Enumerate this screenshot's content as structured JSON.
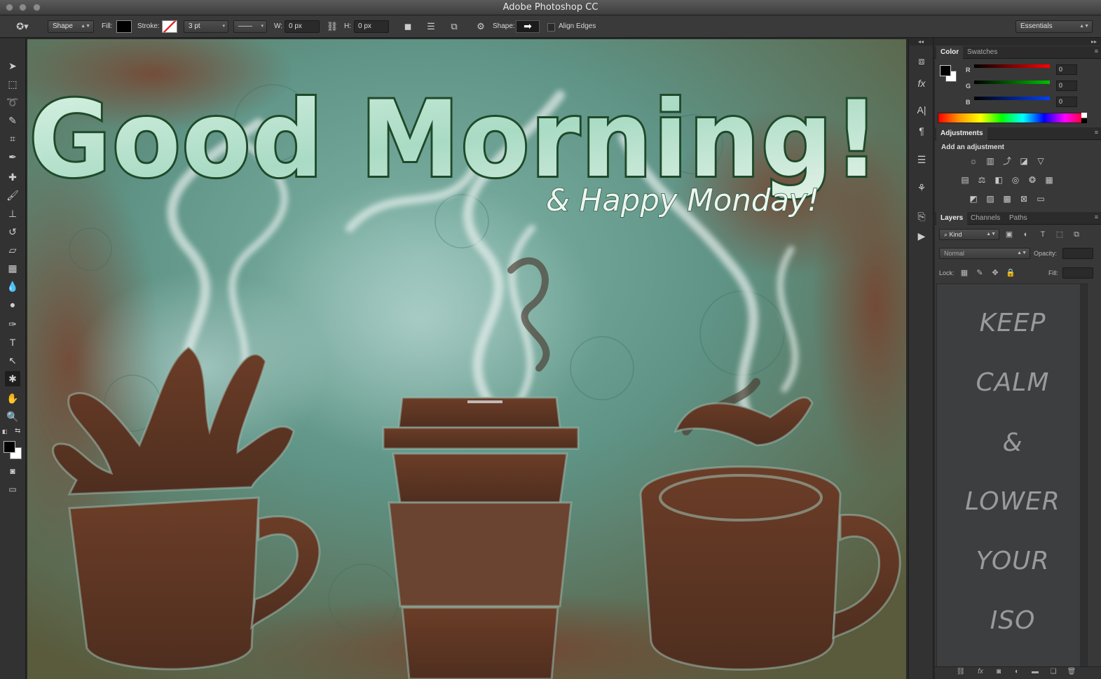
{
  "window": {
    "title": "Adobe Photoshop CC"
  },
  "options_bar": {
    "tool_mode": "Shape",
    "fill_label": "Fill:",
    "stroke_label": "Stroke:",
    "stroke_width": "3 pt",
    "w_label": "W:",
    "w_value": "0 px",
    "h_label": "H:",
    "h_value": "0 px",
    "shape_label": "Shape:",
    "align_edges_label": "Align Edges",
    "workspace": "Essentials"
  },
  "toolbox": {
    "tools": [
      "move-tool",
      "marquee-tool",
      "lasso-tool",
      "quick-selection-tool",
      "crop-tool",
      "eyedropper-tool",
      "spot-healing-tool",
      "brush-tool",
      "clone-stamp-tool",
      "history-brush-tool",
      "eraser-tool",
      "gradient-tool",
      "blur-tool",
      "dodge-tool",
      "pen-tool",
      "type-tool",
      "path-selection-tool",
      "custom-shape-tool",
      "hand-tool",
      "zoom-tool"
    ]
  },
  "canvas": {
    "headline": "Good Morning!",
    "subheadline": "& Happy Monday!",
    "colors": {
      "bg": "#5f8a7d",
      "cup": "#5a3422",
      "text_outline": "#1f4a2a"
    }
  },
  "color_panel": {
    "tabs": [
      "Color",
      "Swatches"
    ],
    "r_label": "R",
    "r_value": "0",
    "g_label": "G",
    "g_value": "0",
    "b_label": "B",
    "b_value": "0"
  },
  "adjustments_panel": {
    "tab": "Adjustments",
    "heading": "Add an adjustment"
  },
  "layers_panel": {
    "tabs": [
      "Layers",
      "Channels",
      "Paths"
    ],
    "filter_kind": "Kind",
    "blend_mode": "Normal",
    "opacity_label": "Opacity:",
    "lock_label": "Lock:",
    "fill_label": "Fill:",
    "preview_lines": [
      "KEEP",
      "CALM",
      "&",
      "LOWER",
      "YOUR",
      "ISO"
    ]
  }
}
